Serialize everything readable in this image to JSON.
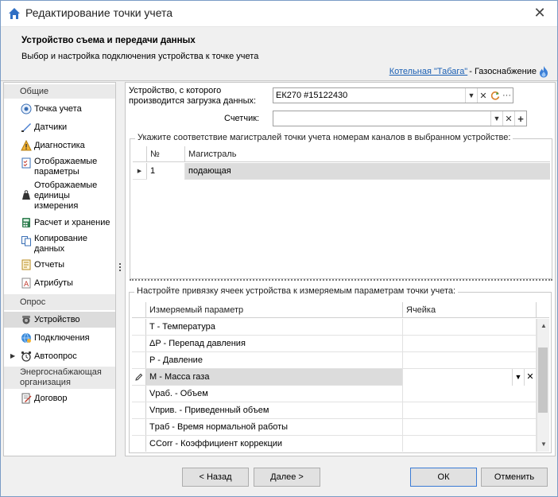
{
  "window": {
    "title": "Редактирование точки учета"
  },
  "header": {
    "title": "Устройство съема и передачи данных",
    "subtitle": "Выбор и настройка подключения устройства к точке учета",
    "org_link": "Котельная \"Табага\"",
    "org_suffix": " - Газоснабжение"
  },
  "nav": {
    "group_general": "Общие",
    "items_general": [
      {
        "label": "Точка учета",
        "icon": "meter-point-icon"
      },
      {
        "label": "Датчики",
        "icon": "sensor-icon"
      },
      {
        "label": "Диагностика",
        "icon": "warning-icon"
      },
      {
        "label": "Отображаемые параметры",
        "icon": "checklist-icon"
      },
      {
        "label": "Отображаемые единицы измерения",
        "icon": "weight-icon"
      },
      {
        "label": "Расчет и хранение",
        "icon": "calculator-icon"
      },
      {
        "label": "Копирование данных",
        "icon": "copy-icon"
      },
      {
        "label": "Отчеты",
        "icon": "report-icon"
      },
      {
        "label": "Атрибуты",
        "icon": "attribute-icon"
      }
    ],
    "group_poll": "Опрос",
    "items_poll": [
      {
        "label": "Устройство",
        "icon": "device-icon",
        "selected": true
      },
      {
        "label": "Подключения",
        "icon": "connection-icon"
      },
      {
        "label": "Автоопрос",
        "icon": "alarm-clock-icon"
      }
    ],
    "group_supplier": "Энергоснабжающая организация",
    "items_supplier": [
      {
        "label": "Договор",
        "icon": "contract-icon"
      }
    ]
  },
  "device": {
    "label": "Устройство, с которого производится загрузка данных:",
    "value": "ЕК270 #15122430",
    "counter_label": "Счетчик:",
    "counter_value": ""
  },
  "channels": {
    "title": "Укажите соответствие магистралей точки учета номерам каналов в выбранном устройстве:",
    "col_no": "№",
    "col_main": "Магистраль",
    "rows": [
      {
        "no": "1",
        "main": "подающая"
      }
    ]
  },
  "binding": {
    "title": "Настройте привязку ячеек устройства к измеряемым параметрам точки учета:",
    "col_param": "Измеряемый параметр",
    "col_cell": "Ячейка",
    "rows": [
      {
        "param": "T - Температура",
        "cell": ""
      },
      {
        "param": "ΔP - Перепад давления",
        "cell": ""
      },
      {
        "param": "P - Давление",
        "cell": ""
      },
      {
        "param": "M - Масса газа",
        "cell": "",
        "active": true
      },
      {
        "param": "Vраб. - Объем",
        "cell": ""
      },
      {
        "param": "Vприв. - Приведенный объем",
        "cell": ""
      },
      {
        "param": "Tраб - Время нормальной работы",
        "cell": ""
      },
      {
        "param": "CCorr - Коэффициент коррекции",
        "cell": ""
      }
    ]
  },
  "footer": {
    "back": "< Назад",
    "next": "Далее >",
    "ok": "ОК",
    "cancel": "Отменить"
  },
  "colors": {
    "accent": "#1a5fb4",
    "link": "#1a5fb4",
    "selection": "#dcdcdc"
  }
}
